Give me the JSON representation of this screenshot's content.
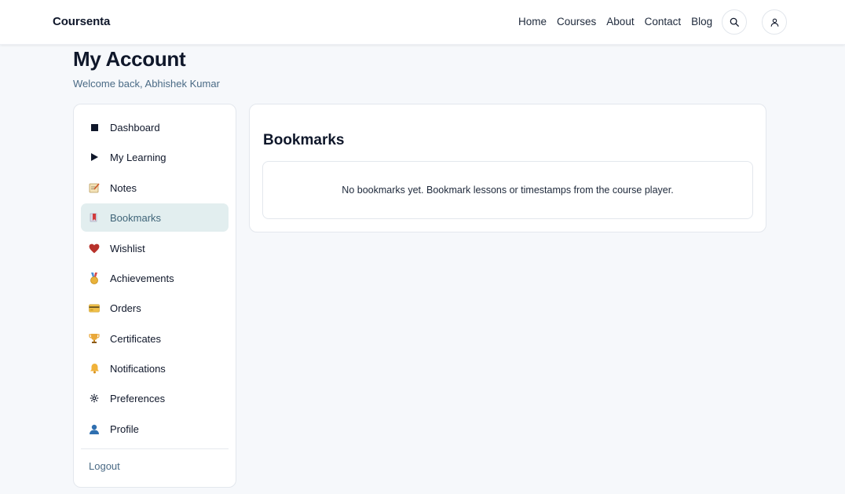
{
  "header": {
    "brand": "Coursenta",
    "nav": [
      "Home",
      "Courses",
      "About",
      "Contact",
      "Blog"
    ],
    "search_icon": "search-icon",
    "user_icon": "user-icon"
  },
  "page": {
    "title": "My Account",
    "welcome": "Welcome back, Abhishek Kumar"
  },
  "sidebar": {
    "items": [
      {
        "label": "Dashboard",
        "icon": "square-icon"
      },
      {
        "label": "My Learning",
        "icon": "play-icon"
      },
      {
        "label": "Notes",
        "icon": "memo-icon"
      },
      {
        "label": "Bookmarks",
        "icon": "bookmark-icon",
        "active": true
      },
      {
        "label": "Wishlist",
        "icon": "heart-icon"
      },
      {
        "label": "Achievements",
        "icon": "medal-icon"
      },
      {
        "label": "Orders",
        "icon": "credit-card-icon"
      },
      {
        "label": "Certificates",
        "icon": "trophy-icon"
      },
      {
        "label": "Notifications",
        "icon": "bell-icon"
      },
      {
        "label": "Preferences",
        "icon": "gear-icon"
      },
      {
        "label": "Profile",
        "icon": "person-icon"
      }
    ],
    "logout": "Logout"
  },
  "main": {
    "title": "Bookmarks",
    "empty_message": "No bookmarks yet. Bookmark lessons or timestamps from the course player."
  },
  "colors": {
    "background": "#f6f8fb",
    "active_item": "#e2eeef",
    "muted_text": "#4a6a85"
  }
}
